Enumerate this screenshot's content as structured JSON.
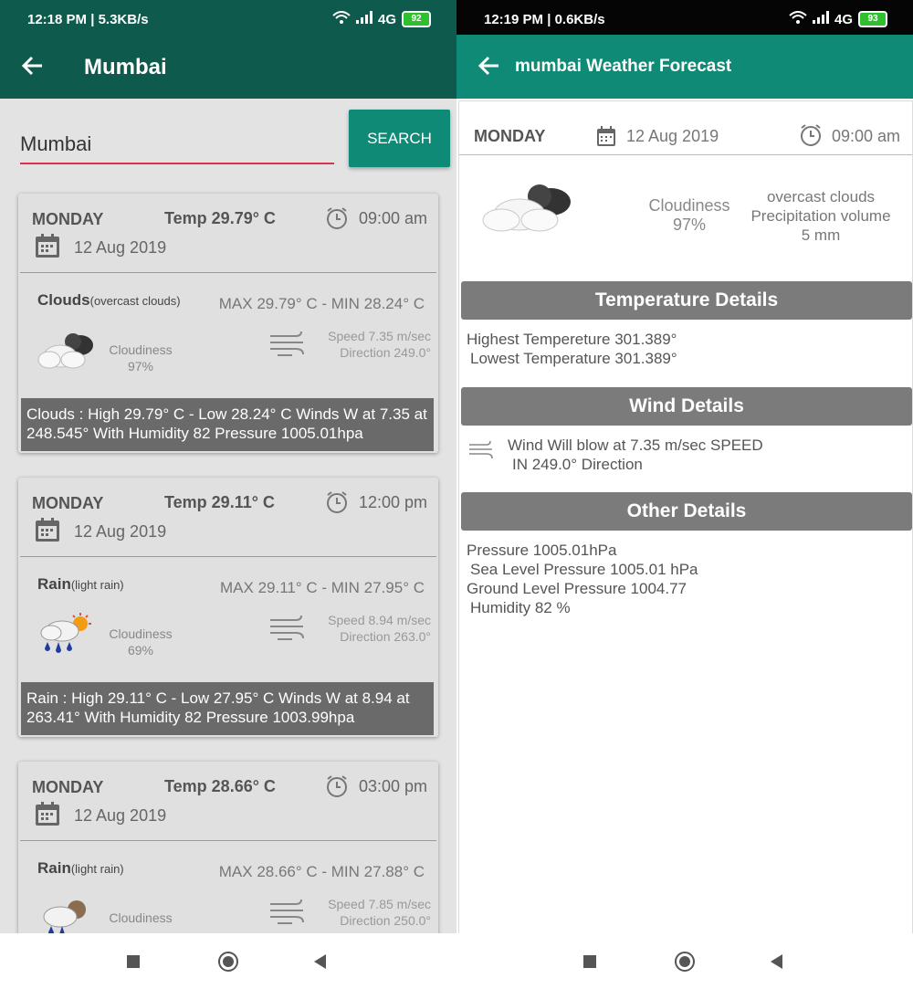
{
  "left": {
    "status": {
      "time_info": "12:18 PM | 5.3KB/s",
      "network": "4G",
      "battery": "92"
    },
    "appbar": {
      "title": "Mumbai"
    },
    "search": {
      "value": "Mumbai",
      "button_label": "SEARCH"
    },
    "cards": [
      {
        "day": "MONDAY",
        "temp": "Temp 29.79° C",
        "time": "09:00 am",
        "date": "12 Aug 2019",
        "condition": "Clouds",
        "condition_detail": "(overcast clouds)",
        "maxmin": "MAX 29.79° C - MIN 28.24° C",
        "cloudiness_label": "Cloudiness",
        "cloudiness_value": "97%",
        "speed": "Speed 7.35 m/sec",
        "direction": "Direction 249.0°",
        "summary": "Clouds : High 29.79° C - Low 28.24° C Winds W at 7.35 at 248.545° With Humidity 82 Pressure 1005.01hpa",
        "icon": "cloud-icon"
      },
      {
        "day": "MONDAY",
        "temp": "Temp 29.11° C",
        "time": "12:00 pm",
        "date": "12 Aug 2019",
        "condition": "Rain",
        "condition_detail": "(light rain)",
        "maxmin": "MAX 29.11° C - MIN 27.95° C",
        "cloudiness_label": "Cloudiness",
        "cloudiness_value": "69%",
        "speed": "Speed 8.94 m/sec",
        "direction": "Direction 263.0°",
        "summary": "Rain : High 29.11° C - Low 27.95° C Winds W at 8.94 at 263.41° With Humidity 82 Pressure 1003.99hpa",
        "icon": "rain-sun-icon"
      },
      {
        "day": "MONDAY",
        "temp": "Temp 28.66° C",
        "time": "03:00 pm",
        "date": "12 Aug 2019",
        "condition": "Rain",
        "condition_detail": "(light rain)",
        "maxmin": "MAX 28.66° C - MIN 27.88° C",
        "cloudiness_label": "Cloudiness",
        "cloudiness_value": "",
        "speed": "Speed 7.85 m/sec",
        "direction": "Direction 250.0°",
        "summary": "",
        "icon": "rain-icon"
      }
    ]
  },
  "right": {
    "status": {
      "time_info": "12:19 PM | 0.6KB/s",
      "network": "4G",
      "battery": "93"
    },
    "appbar": {
      "title": "mumbai Weather Forecast"
    },
    "header": {
      "day": "MONDAY",
      "date": "12 Aug 2019",
      "time": "09:00 am"
    },
    "summary": {
      "cloudiness_label": "Cloudiness",
      "cloudiness_value": "97%",
      "desc_1": "overcast clouds",
      "desc_2": "Precipitation volume",
      "desc_3": "5 mm"
    },
    "temperature": {
      "title": "Temperature Details",
      "highest": "Highest Tempereture 301.389°",
      "lowest": "Lowest Temperature 301.389°"
    },
    "wind": {
      "title": "Wind Details",
      "line_1": "Wind Will blow at 7.35 m/sec SPEED",
      "line_2": "IN  249.0° Direction"
    },
    "other": {
      "title": "Other Details",
      "pressure": "Pressure  1005.01hPa",
      "sea_level": "Sea Level Pressure 1005.01 hPa",
      "ground_level": "Ground Level Pressure 1004.77",
      "humidity": "Humidity 82 %"
    }
  },
  "colors": {
    "primary_dark": "#0e5b4e",
    "primary": "#0f8a77",
    "accent": "#d8324f"
  }
}
